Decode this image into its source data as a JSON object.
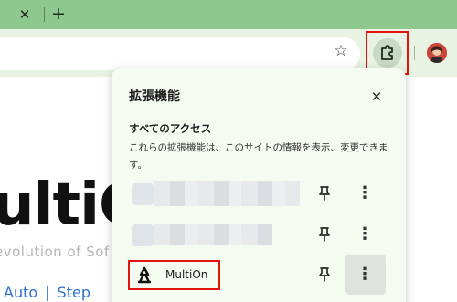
{
  "browser": {
    "tab_close_glyph": "✕",
    "new_tab_glyph": "+",
    "bookmark_star_glyph": "☆",
    "extensions_icon": "puzzle-icon"
  },
  "page": {
    "hero_text": "ultiC",
    "subtitle": "evolution of Sof",
    "links": [
      "Auto",
      "Step"
    ]
  },
  "popup": {
    "title": "拡張機能",
    "close_glyph": "✕",
    "section_title": "すべてのアクセス",
    "section_desc": "これらの拡張機能は、このサイトの情報を表示、変更できます。",
    "extensions": [
      {
        "name": "",
        "pinned": false
      },
      {
        "name": "",
        "pinned": false
      },
      {
        "name": "MultiOn",
        "pinned": false
      }
    ],
    "more_glyph": "⋮"
  },
  "colors": {
    "tabstrip": "#8fc88f",
    "toolbar": "#e9f3e4",
    "popup_bg": "#f4fbf1",
    "highlight_red": "#e3140e",
    "link_blue": "#2f6fd0"
  }
}
